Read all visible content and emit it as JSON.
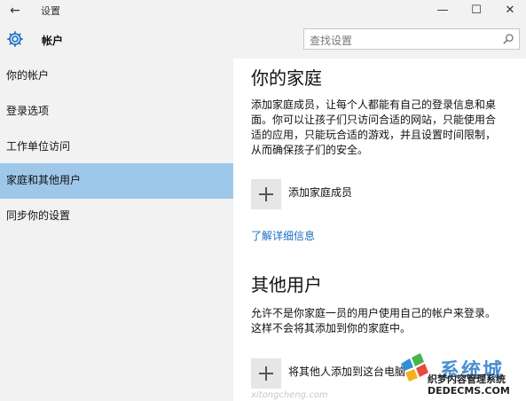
{
  "titlebar": {
    "back_glyph": "←",
    "title": "设置",
    "min_glyph": "—",
    "max_glyph": "☐",
    "close_glyph": "✕"
  },
  "header": {
    "title": "帐户",
    "icon": "gear-icon",
    "search_placeholder": "查找设置",
    "search_icon": "search-icon"
  },
  "sidebar": {
    "items": [
      {
        "label": "你的帐户"
      },
      {
        "label": "登录选项"
      },
      {
        "label": "工作单位访问"
      },
      {
        "label": "家庭和其他用户",
        "selected": true
      },
      {
        "label": "同步你的设置"
      }
    ]
  },
  "content": {
    "family_title": "你的家庭",
    "family_desc": [
      "添加家庭成员，让每个人都能有自己的登录信息和桌",
      "面。你可以让孩子们只访问合适的网站，只能使用合",
      "适的应用，只能玩合适的游戏，并且设置时间限制，",
      "从而确保孩子们的安全。"
    ],
    "add_family_label": "添加家庭成员",
    "learn_more": "了解详细信息",
    "others_title": "其他用户",
    "others_desc": [
      "允许不是你家庭一员的用户使用自己的帐户来登录。",
      "这样不会将其添加到你的家庭中。"
    ],
    "add_other_label": "将其他人添加到这台电脑"
  },
  "watermark": {
    "brand": "系统城",
    "line1": "织梦内容管理系统",
    "line2": "DEDECMS.COM",
    "faint": "xitongcheng.com"
  },
  "colors": {
    "selected_bg": "#9ec8ea",
    "link": "#1a6fc4",
    "sidebar_bg": "#f2f2f2",
    "content_bg": "#ffffff"
  }
}
